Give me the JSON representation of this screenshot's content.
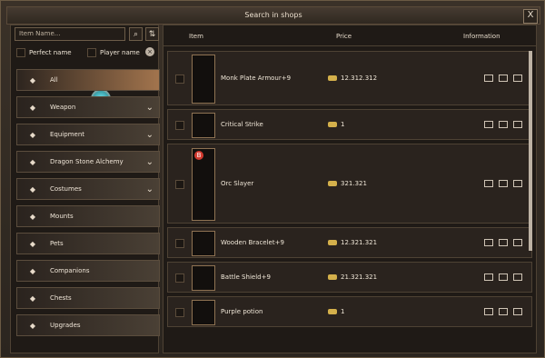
{
  "window": {
    "title": "Search in shops",
    "close_label": "X"
  },
  "left": {
    "search": {
      "placeholder": "Item Name..."
    },
    "filters": [
      {
        "label": "Perfect name"
      },
      {
        "label": "Player name"
      }
    ],
    "categories": [
      {
        "label": "All",
        "icon": "all-icon",
        "has_chevron": false
      },
      {
        "label": "Weapon",
        "icon": "sword-icon",
        "has_chevron": true
      },
      {
        "label": "Equipment",
        "icon": "armor-icon",
        "has_chevron": true
      },
      {
        "label": "Dragon Stone Alchemy",
        "icon": "dragon-stone-icon",
        "has_chevron": true
      },
      {
        "label": "Costumes",
        "icon": "costume-icon",
        "has_chevron": true
      },
      {
        "label": "Mounts",
        "icon": "mount-icon",
        "has_chevron": false
      },
      {
        "label": "Pets",
        "icon": "pet-icon",
        "has_chevron": false
      },
      {
        "label": "Companions",
        "icon": "paw-icon",
        "has_chevron": false
      },
      {
        "label": "Chests",
        "icon": "chest-icon",
        "has_chevron": false
      },
      {
        "label": "Upgrades",
        "icon": "upgrade-icon",
        "has_chevron": false
      }
    ]
  },
  "right": {
    "headers": {
      "item": "Item",
      "price": "Price",
      "information": "Information"
    },
    "rows": [
      {
        "name": "Monk Plate Armour+9",
        "price": "12.312.312",
        "icon": "armor-icon"
      },
      {
        "name": "Critical Strike",
        "price": "1",
        "icon": "arrow-icon"
      },
      {
        "name": "Orc Slayer",
        "price": "321.321",
        "icon": "sword-icon",
        "badge": "B"
      },
      {
        "name": "Wooden Bracelet+9",
        "price": "12.321.321",
        "icon": "bracelet-icon"
      },
      {
        "name": "Battle Shield+9",
        "price": "21.321.321",
        "icon": "shield-icon"
      },
      {
        "name": "Purple potion",
        "price": "1",
        "icon": "potion-icon"
      }
    ]
  },
  "colors": {
    "accent": "#a2744d",
    "gold": "#d4b04b"
  }
}
